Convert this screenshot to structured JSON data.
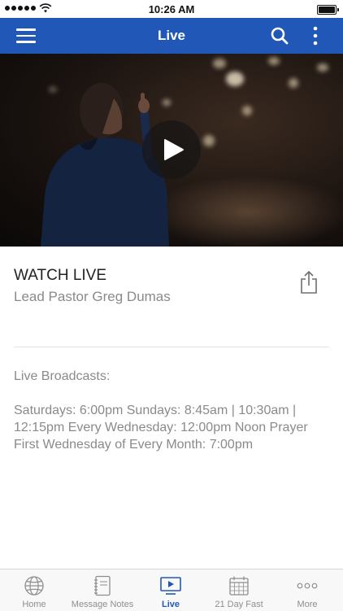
{
  "status_bar": {
    "time": "10:26 AM"
  },
  "nav": {
    "title": "Live"
  },
  "content": {
    "title": "WATCH LIVE",
    "subtitle": "Lead Pastor Greg Dumas",
    "broadcast_heading": "Live Broadcasts:",
    "schedule_lines": [
      "Saturdays: 6:00pm  Sundays: 8:45am | 10:30am |",
      "12:15pm Every Wednesday: 12:00pm Noon Prayer",
      "First Wednesday of Every Month: 7:00pm"
    ]
  },
  "tabs": [
    {
      "label": "Home",
      "icon": "globe-icon",
      "active": false
    },
    {
      "label": "Message Notes",
      "icon": "notebook-icon",
      "active": false
    },
    {
      "label": "Live",
      "icon": "tv-play-icon",
      "active": true
    },
    {
      "label": "21 Day Fast",
      "icon": "calendar-icon",
      "active": false
    },
    {
      "label": "More",
      "icon": "more-dots-icon",
      "active": false
    }
  ],
  "colors": {
    "brand": "#2158b8",
    "tab_inactive": "#8e8e8e"
  }
}
